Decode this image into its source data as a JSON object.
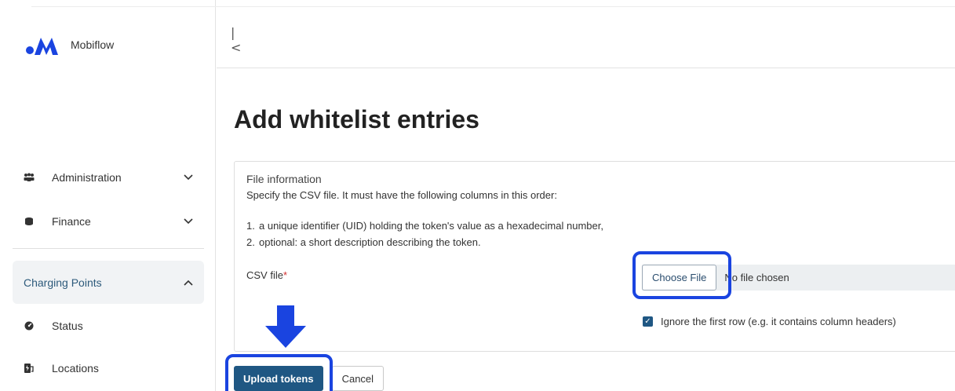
{
  "sidebar": {
    "brand_name": "Mobiflow",
    "items": [
      {
        "label": "Administration",
        "icon": "users-icon",
        "expanded": false
      },
      {
        "label": "Finance",
        "icon": "coins-icon",
        "expanded": false
      },
      {
        "label": "Charging Points",
        "icon": "",
        "expanded": true
      },
      {
        "label": "Status",
        "icon": "gauge-icon"
      },
      {
        "label": "Locations",
        "icon": "charging-station-icon"
      }
    ]
  },
  "header": {
    "collapse_icon": "collapse-left-icon"
  },
  "main": {
    "title": "Add whitelist entries",
    "panel": {
      "title": "File information",
      "description": "Specify the CSV file. It must have the following columns in this order:",
      "columns": [
        "a unique identifier (UID) holding the token's value as a hexadecimal number,",
        "optional: a short description describing the token."
      ],
      "csv_label": "CSV file",
      "required_marker": "*",
      "choose_file_label": "Choose File",
      "file_status": "No file chosen",
      "ignore_first_row_label": "Ignore the first row (e.g. it contains column headers)",
      "ignore_first_row_checked": true
    },
    "actions": {
      "upload_label": "Upload tokens",
      "cancel_label": "Cancel"
    }
  },
  "colors": {
    "primary": "#1f5783",
    "highlight": "#1a44e0",
    "brand": "#1a44e0"
  }
}
